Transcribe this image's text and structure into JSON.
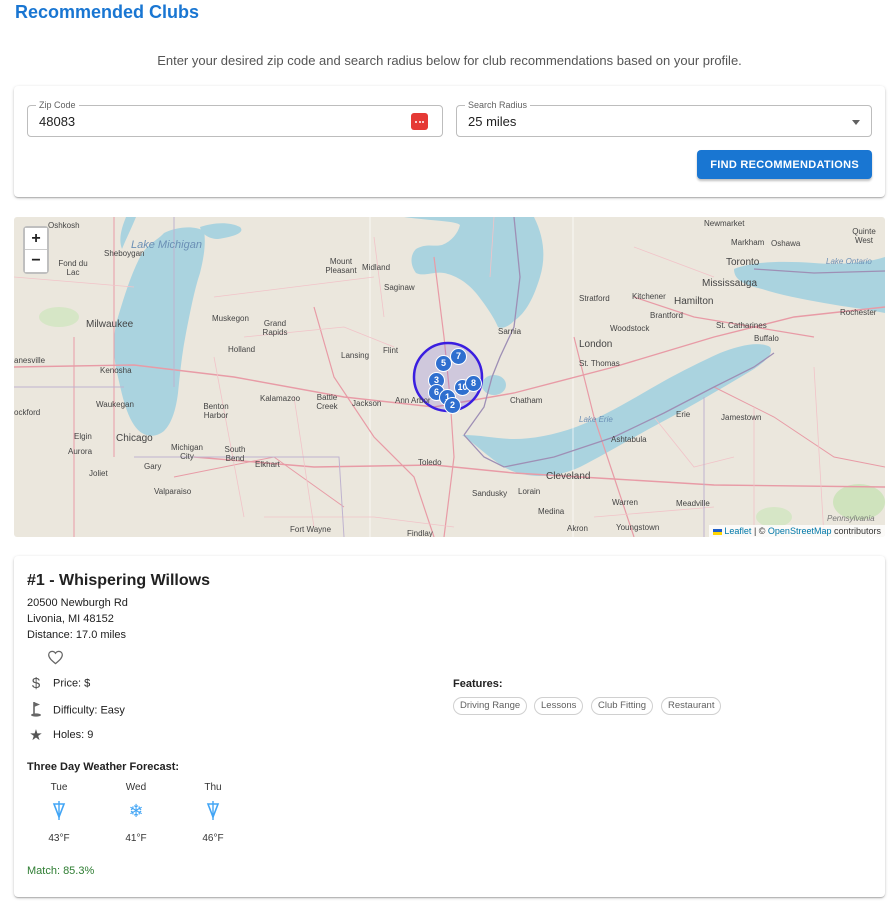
{
  "page": {
    "title": "Recommended Clubs",
    "intro": "Enter your desired zip code and search radius below for club recommendations based on your profile."
  },
  "search": {
    "zip_label": "Zip Code",
    "zip_value": "48083",
    "radius_label": "Search Radius",
    "radius_value": "25 miles",
    "button_label": "FIND RECOMMENDATIONS"
  },
  "map": {
    "zoom_in": "+",
    "zoom_out": "−",
    "attribution_leaflet": "Leaflet",
    "attribution_sep": " | © ",
    "attribution_osm": "OpenStreetMap",
    "attribution_tail": " contributors",
    "water_labels": [
      "Lake Michigan",
      "Lake Ontario",
      "Lake Erie"
    ],
    "clusters": [
      "5",
      "7",
      "3",
      "10",
      "8",
      "6",
      "1",
      "2"
    ],
    "places": [
      "Oshkosh",
      "Sheboygan",
      "Fond du Lac",
      "Milwaukee",
      "Kenosha",
      "Waukegan",
      "Elgin",
      "Aurora",
      "Joliet",
      "Chicago",
      "Gary",
      "Valparaiso",
      "Michigan City",
      "South Bend",
      "Elkhart",
      "Benton Harbor",
      "Kalamazoo",
      "Battle Creek",
      "Jackson",
      "Ann Arbor",
      "Holland",
      "Grand Rapids",
      "Muskegon",
      "Lansing",
      "Flint",
      "Saginaw",
      "Midland",
      "Mount Pleasant",
      "Sarnia",
      "London",
      "St. Thomas",
      "Chatham",
      "Toledo",
      "Sandusky",
      "Lorain",
      "Cleveland",
      "Akron",
      "Medina",
      "Warren",
      "Youngstown",
      "Meadville",
      "Erie",
      "Ashtabula",
      "Jamestown",
      "Buffalo",
      "Rochester",
      "Hamilton",
      "Mississauga",
      "Toronto",
      "Oshawa",
      "Markham",
      "Newmarket",
      "Quinte West",
      "Kitchener",
      "Stratford",
      "Brantford",
      "Woodstock",
      "St. Catharines",
      "Fort Wayne",
      "Findlay",
      "Pennsylvania",
      "anesville",
      "ockford"
    ]
  },
  "club": {
    "title": "#1 - Whispering Willows",
    "address1": "20500 Newburgh Rd",
    "address2": "Livonia, MI 48152",
    "distance": "Distance: 17.0 miles",
    "price": "Price: $",
    "difficulty": "Difficulty: Easy",
    "holes": "Holes: 9",
    "features_label": "Features:",
    "features": [
      "Driving Range",
      "Lessons",
      "Club Fitting",
      "Restaurant"
    ],
    "weather_title": "Three Day Weather Forecast:",
    "forecast": [
      {
        "day": "Tue",
        "temp": "43°F",
        "icon": "rain-icon"
      },
      {
        "day": "Wed",
        "temp": "41°F",
        "icon": "snow-icon"
      },
      {
        "day": "Thu",
        "temp": "46°F",
        "icon": "rain-icon"
      }
    ],
    "match": "Match: 85.3%"
  },
  "colors": {
    "primary": "#1976d2",
    "water": "#aad3df",
    "land": "#ebe7dd",
    "cluster": "#2f6fcf",
    "match_green": "#2e7d32"
  }
}
